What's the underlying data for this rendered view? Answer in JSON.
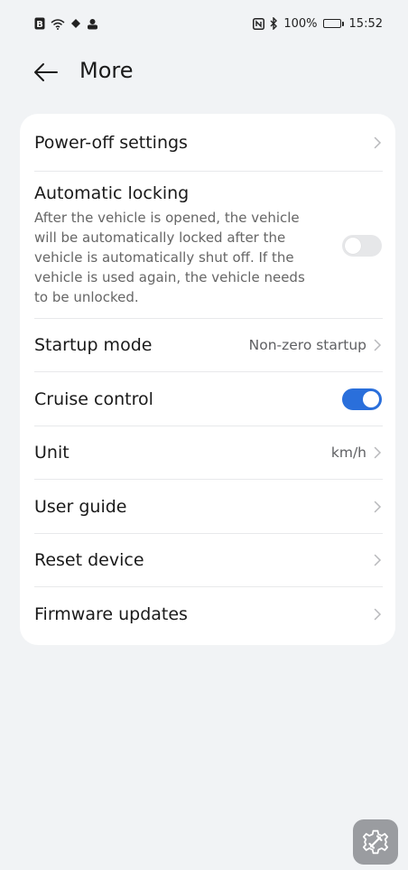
{
  "status_bar": {
    "battery_percent": "100%",
    "time": "15:52"
  },
  "header": {
    "title": "More"
  },
  "settings": {
    "power_off": {
      "title": "Power-off settings"
    },
    "auto_lock": {
      "title": "Automatic locking",
      "description": "After the vehicle is opened, the vehicle will be automatically locked after the vehicle is automatically shut off. If the vehicle is used again, the vehicle needs to be unlocked.",
      "enabled": false
    },
    "startup_mode": {
      "title": "Startup mode",
      "value": "Non-zero startup"
    },
    "cruise_control": {
      "title": "Cruise control",
      "enabled": true
    },
    "unit": {
      "title": "Unit",
      "value": "km/h"
    },
    "user_guide": {
      "title": "User guide"
    },
    "reset_device": {
      "title": "Reset device"
    },
    "firmware_updates": {
      "title": "Firmware updates"
    }
  },
  "colors": {
    "toggle_on": "#2a6fdb",
    "toggle_off": "#e6e7e9",
    "background": "#f1f3f5",
    "card": "#ffffff"
  },
  "icons": {
    "back": "arrow-left-icon",
    "chevron": "chevron-right-icon",
    "floating": "gear-wrench-icon"
  }
}
